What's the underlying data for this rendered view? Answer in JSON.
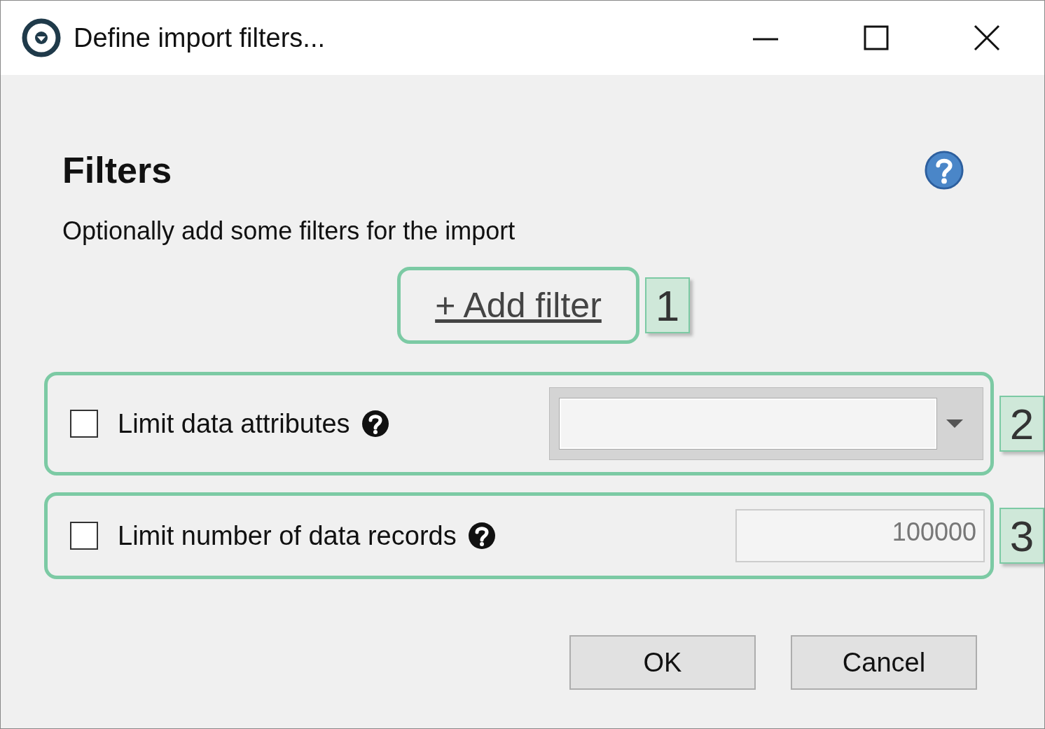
{
  "window": {
    "title": "Define import filters..."
  },
  "header": {
    "title": "Filters"
  },
  "description": "Optionally add some filters for the import",
  "add_filter": {
    "label": "+ Add filter",
    "callout": "1"
  },
  "options": [
    {
      "kind": "dropdown",
      "label": "Limit data attributes",
      "checked": false,
      "callout": "2"
    },
    {
      "kind": "number",
      "label": "Limit number of data records",
      "checked": false,
      "value": "100000",
      "callout": "3"
    }
  ],
  "buttons": [
    "OK",
    "Cancel"
  ]
}
